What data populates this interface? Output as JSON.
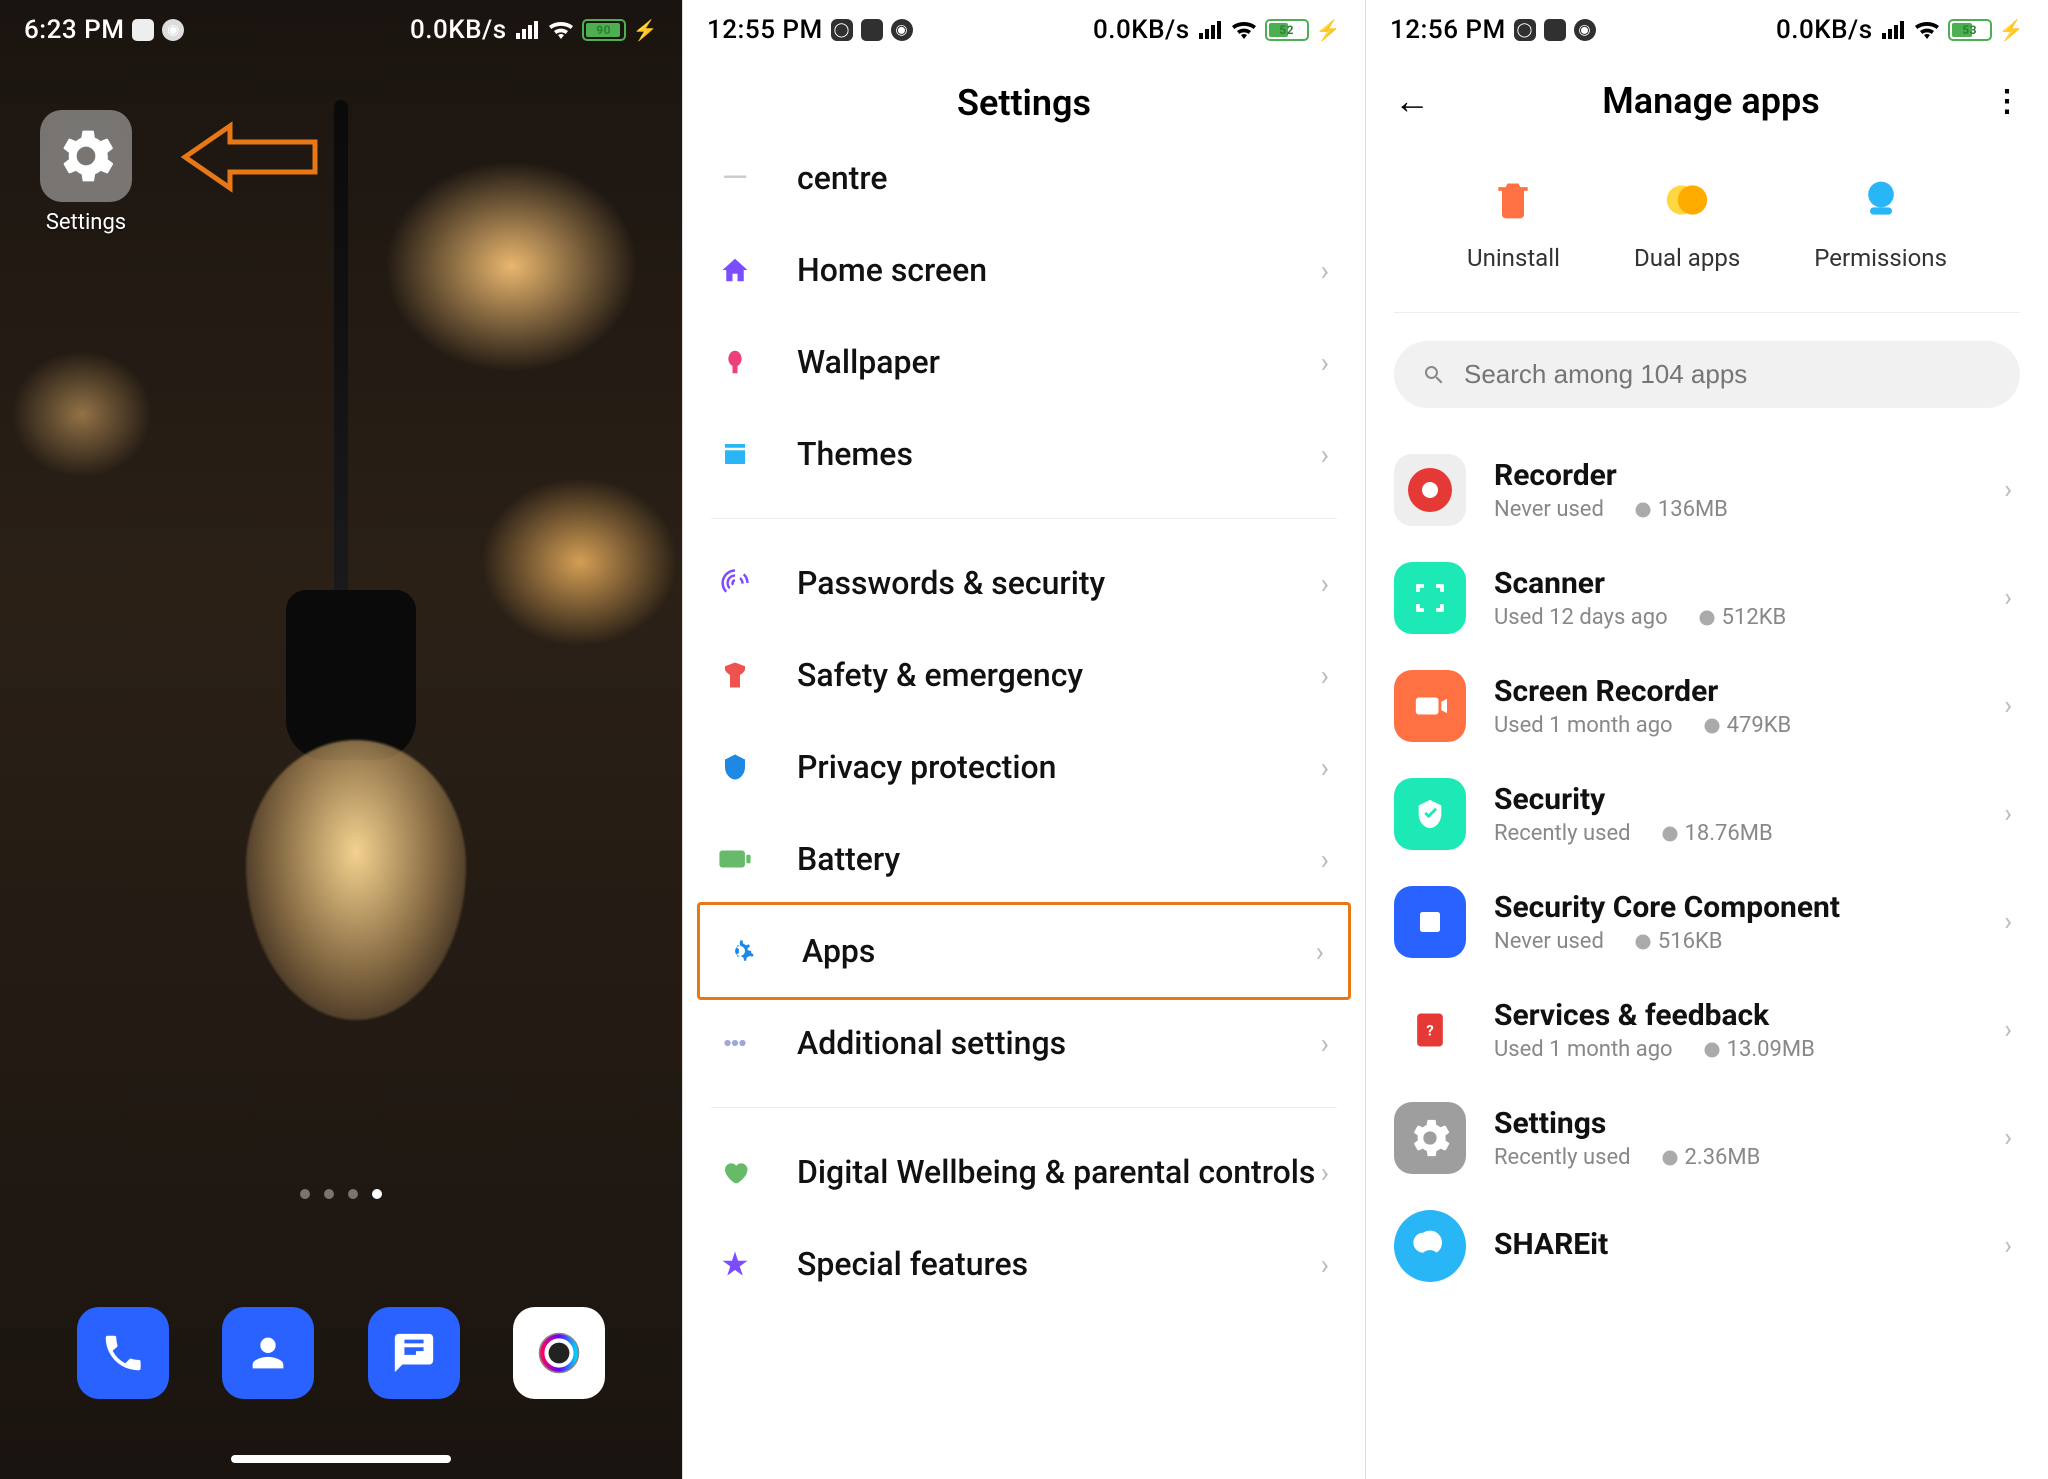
{
  "phone1": {
    "status": {
      "time": "6:23 PM",
      "data": "0.0KB/s",
      "battery": "90"
    },
    "app": {
      "label": "Settings"
    }
  },
  "phone2": {
    "status": {
      "time": "12:55 PM",
      "data": "0.0KB/s",
      "battery": "52"
    },
    "title": "Settings",
    "partial": "centre",
    "items": [
      {
        "label": "Home screen",
        "icon": "home",
        "color": "#7c4dff"
      },
      {
        "label": "Wallpaper",
        "icon": "wallpaper",
        "color": "#ec407a"
      },
      {
        "label": "Themes",
        "icon": "themes",
        "color": "#29b6f6"
      }
    ],
    "group2": [
      {
        "label": "Passwords & security",
        "icon": "fingerprint",
        "color": "#7c4dff"
      },
      {
        "label": "Safety & emergency",
        "icon": "safety",
        "color": "#ef5350"
      },
      {
        "label": "Privacy protection",
        "icon": "privacy",
        "color": "#1e88e5"
      },
      {
        "label": "Battery",
        "icon": "battery",
        "color": "#66bb6a"
      },
      {
        "label": "Apps",
        "icon": "apps",
        "color": "#1e88e5",
        "highlight": true
      },
      {
        "label": "Additional settings",
        "icon": "more",
        "color": "#9fa8da"
      }
    ],
    "group3": [
      {
        "label": "Digital Wellbeing & parental controls",
        "icon": "wellbeing",
        "color": "#66bb6a"
      },
      {
        "label": "Special features",
        "icon": "special",
        "color": "#7c4dff"
      }
    ]
  },
  "phone3": {
    "status": {
      "time": "12:56 PM",
      "data": "0.0KB/s",
      "battery": "53"
    },
    "title": "Manage apps",
    "actions": [
      "Uninstall",
      "Dual apps",
      "Permissions"
    ],
    "search_placeholder": "Search among 104 apps",
    "apps": [
      {
        "name": "Recorder",
        "usage": "Never used",
        "size": "136MB",
        "cls": "ic-recorder"
      },
      {
        "name": "Scanner",
        "usage": "Used 12 days ago",
        "size": "512KB",
        "cls": "ic-scanner"
      },
      {
        "name": "Screen Recorder",
        "usage": "Used 1 month ago",
        "size": "479KB",
        "cls": "ic-screenrec"
      },
      {
        "name": "Security",
        "usage": "Recently used",
        "size": "18.76MB",
        "cls": "ic-security"
      },
      {
        "name": "Security Core Component",
        "usage": "Never used",
        "size": "516KB",
        "cls": "ic-seccore"
      },
      {
        "name": "Services & feedback",
        "usage": "Used 1 month ago",
        "size": "13.09MB",
        "cls": "ic-services"
      },
      {
        "name": "Settings",
        "usage": "Recently used",
        "size": "2.36MB",
        "cls": "ic-settings"
      },
      {
        "name": "SHAREit",
        "usage": "",
        "size": "",
        "cls": "ic-shareit"
      }
    ]
  }
}
